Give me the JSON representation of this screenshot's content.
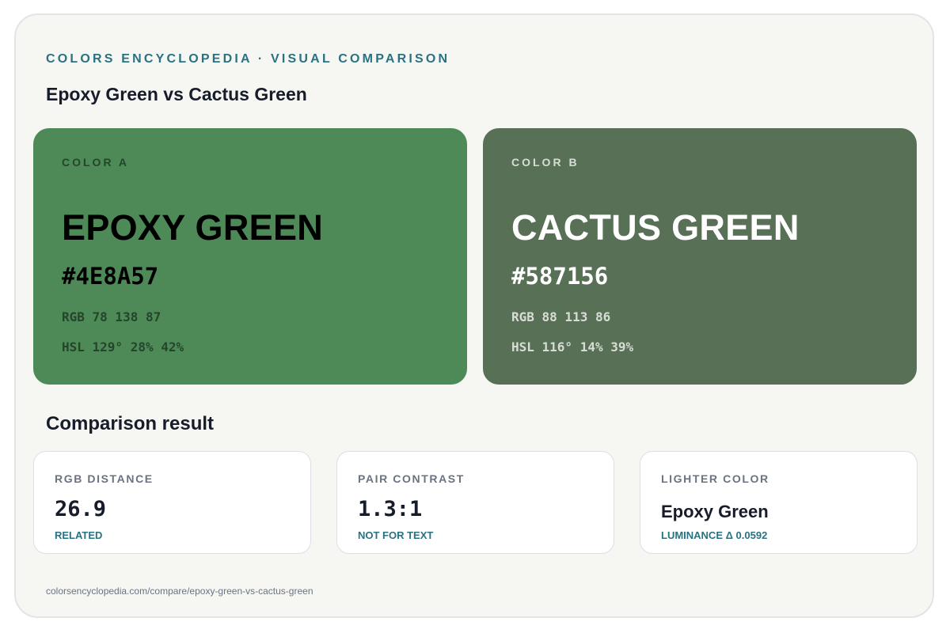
{
  "header": {
    "eyebrow": "COLORS ENCYCLOPEDIA · VISUAL COMPARISON",
    "title": "Epoxy Green vs Cactus Green"
  },
  "color_a": {
    "tag": "COLOR A",
    "name": "EPOXY GREEN",
    "hex": "#4E8A57",
    "rgb": "RGB 78 138 87",
    "hsl": "HSL 129° 28% 42%",
    "background": "#4E8A57",
    "tag_color": "#25452b",
    "text_color": "#000000",
    "meta_color": "#25452b"
  },
  "color_b": {
    "tag": "COLOR B",
    "name": "CACTUS GREEN",
    "hex": "#587156",
    "rgb": "RGB 88 113 86",
    "hsl": "HSL 116° 14% 39%",
    "background": "#587156",
    "tag_color": "#d7ddd6",
    "text_color": "#ffffff",
    "meta_color": "#d7ddd6"
  },
  "comparison": {
    "title": "Comparison result",
    "cards": [
      {
        "label": "RGB DISTANCE",
        "value": "26.9",
        "note": "RELATED"
      },
      {
        "label": "PAIR CONTRAST",
        "value": "1.3:1",
        "note": "NOT FOR TEXT"
      },
      {
        "label": "LIGHTER COLOR",
        "value": "Epoxy Green",
        "note": "LUMINANCE Δ 0.0592"
      }
    ]
  },
  "footer": {
    "url": "colorsencyclopedia.com/compare/epoxy-green-vs-cactus-green"
  },
  "colors": {
    "accent": "#2a7282",
    "heading": "#161c2a",
    "muted": "#6b7382",
    "page_background": "#f6f6f3"
  }
}
